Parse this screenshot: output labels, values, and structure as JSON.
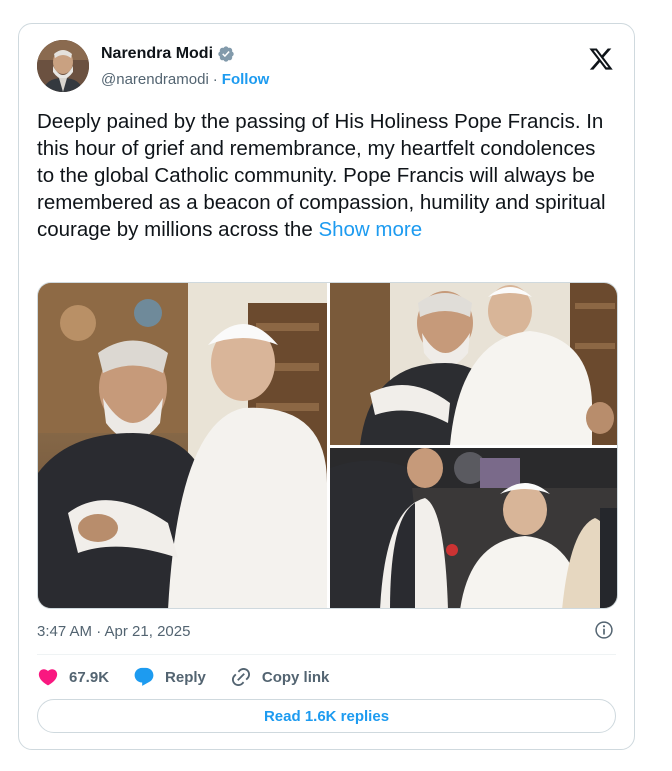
{
  "author": {
    "display_name": "Narendra Modi",
    "handle": "@narendramodi",
    "separator": "·",
    "follow_label": "Follow",
    "verified": true
  },
  "tweet": {
    "text": "Deeply pained by the passing of His Holiness Pope Francis. In this hour of grief and remembrance, my heartfelt condolences to the global Catholic community. Pope Francis will always be remembered as a beacon of compassion, humility and spiritual courage by millions across the ",
    "show_more_label": "Show more"
  },
  "media": [
    {
      "icon": "photo-embrace"
    },
    {
      "icon": "photo-hug"
    },
    {
      "icon": "photo-conversation"
    }
  ],
  "meta": {
    "timestamp": "3:47 AM · Apr 21, 2025"
  },
  "actions": {
    "likes": "67.9K",
    "reply_label": "Reply",
    "copy_link_label": "Copy link"
  },
  "replies": {
    "read_label": "Read 1.6K replies"
  },
  "colors": {
    "accent": "#1d9bf0",
    "like": "#f91880",
    "muted": "#536471",
    "border": "#cfd9de"
  }
}
